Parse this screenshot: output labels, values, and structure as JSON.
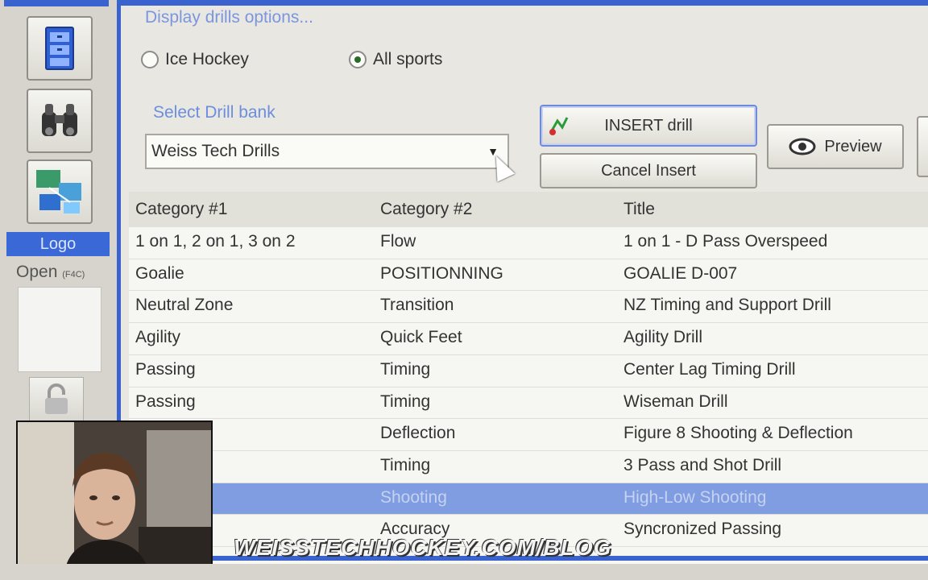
{
  "options_title": "Display drills options...",
  "radios": [
    {
      "label": "Ice Hockey",
      "checked": false
    },
    {
      "label": "All sports",
      "checked": true
    }
  ],
  "drill_bank": {
    "label": "Select Drill bank",
    "value": "Weiss Tech Drills"
  },
  "buttons": {
    "insert": "INSERT drill",
    "cancel": "Cancel Insert",
    "preview": "Preview"
  },
  "sidebar": {
    "logo": "Logo",
    "open": "Open",
    "open_small": "(F4C)"
  },
  "grid": {
    "columns": [
      "Category #1",
      "Category #2",
      "Title"
    ],
    "rows": [
      [
        "1 on 1, 2 on 1, 3 on 2",
        "Flow",
        "1 on 1 - D Pass Overspeed"
      ],
      [
        "Goalie",
        "POSITIONNING",
        "GOALIE D-007"
      ],
      [
        "Neutral Zone",
        "Transition",
        "NZ Timing and Support Drill"
      ],
      [
        "Agility",
        "Quick Feet",
        "Agility Drill"
      ],
      [
        "Passing",
        "Timing",
        "Center Lag Timing Drill"
      ],
      [
        "Passing",
        "Timing",
        "Wiseman Drill"
      ],
      [
        "",
        "Deflection",
        "Figure 8 Shooting & Deflection"
      ],
      [
        "",
        "Timing",
        "3 Pass and Shot Drill"
      ],
      [
        "",
        "Shooting",
        "High-Low Shooting"
      ],
      [
        "",
        "Accuracy",
        "Syncronized Passing"
      ]
    ],
    "selected_row": 8
  },
  "watermark": "WEISSTECHHOCKEY.COM/BLOG",
  "colors": {
    "accent_blue": "#3a63d0",
    "selection": "#7f9de0"
  }
}
